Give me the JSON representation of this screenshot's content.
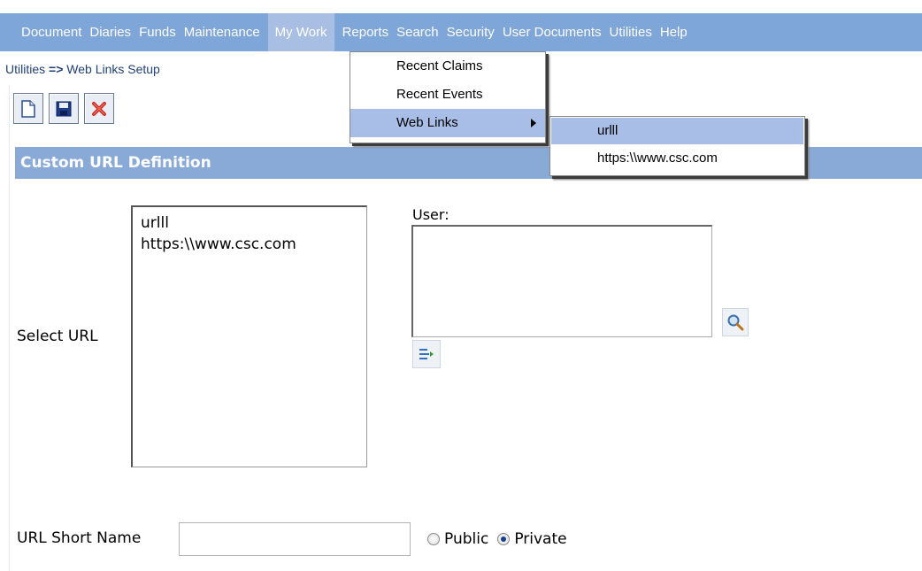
{
  "menubar": {
    "items": [
      {
        "label": "Document"
      },
      {
        "label": "Diaries"
      },
      {
        "label": "Funds"
      },
      {
        "label": "Maintenance"
      },
      {
        "label": "My Work"
      },
      {
        "label": "Reports"
      },
      {
        "label": "Search"
      },
      {
        "label": "Security"
      },
      {
        "label": "User Documents"
      },
      {
        "label": "Utilities"
      },
      {
        "label": "Help"
      }
    ]
  },
  "breadcrumb": {
    "parent": "Utilities",
    "separator": "=>",
    "current": "Web Links Setup"
  },
  "toolbar": {
    "new_icon": "new-document-icon",
    "save_icon": "save-disk-icon",
    "delete_icon": "delete-x-icon"
  },
  "section": {
    "title": "Custom URL Definition"
  },
  "form": {
    "select_url_label": "Select URL",
    "url_options": [
      "urlll",
      "https:\\\\www.csc.com"
    ],
    "user_label": "User:",
    "short_name_label": "URL Short Name",
    "short_name_value": "",
    "visibility": {
      "public_label": "Public",
      "private_label": "Private",
      "selected": "Private"
    }
  },
  "mywork_menu": {
    "items": [
      {
        "label": "Recent Claims"
      },
      {
        "label": "Recent Events"
      },
      {
        "label": "Web Links"
      }
    ]
  },
  "weblinks_submenu": {
    "items": [
      {
        "label": "urlll"
      },
      {
        "label": "https:\\\\www.csc.com"
      }
    ]
  },
  "colors": {
    "menubar_bg": "#7fa6d8",
    "section_header_bg": "#89aad6",
    "highlight": "#a8bee6"
  }
}
